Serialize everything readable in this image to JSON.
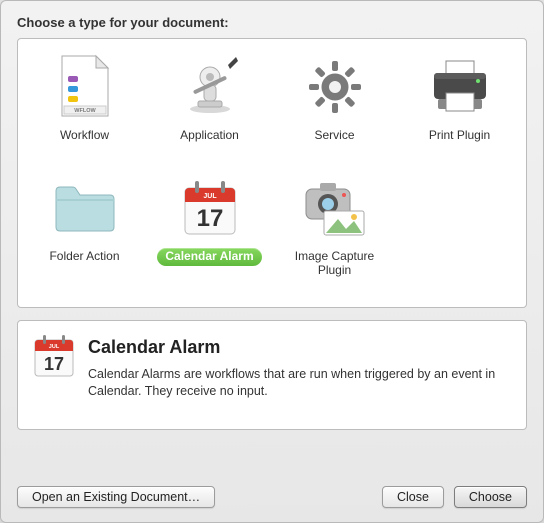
{
  "prompt": "Choose a type for your document:",
  "types": [
    {
      "id": "workflow",
      "label": "Workflow"
    },
    {
      "id": "application",
      "label": "Application"
    },
    {
      "id": "service",
      "label": "Service"
    },
    {
      "id": "print-plugin",
      "label": "Print Plugin"
    },
    {
      "id": "folder-action",
      "label": "Folder Action"
    },
    {
      "id": "calendar-alarm",
      "label": "Calendar Alarm",
      "selected": true
    },
    {
      "id": "image-capture-plugin",
      "label": "Image Capture Plugin"
    }
  ],
  "description": {
    "title": "Calendar Alarm",
    "body": "Calendar Alarms are workflows that are run when triggered by an event in Calendar. They receive no input."
  },
  "buttons": {
    "open_existing": "Open an Existing Document…",
    "close": "Close",
    "choose": "Choose"
  },
  "icons": {
    "workflow_badge": "WFLOW",
    "calendar_month": "JUL",
    "calendar_day": "17"
  }
}
